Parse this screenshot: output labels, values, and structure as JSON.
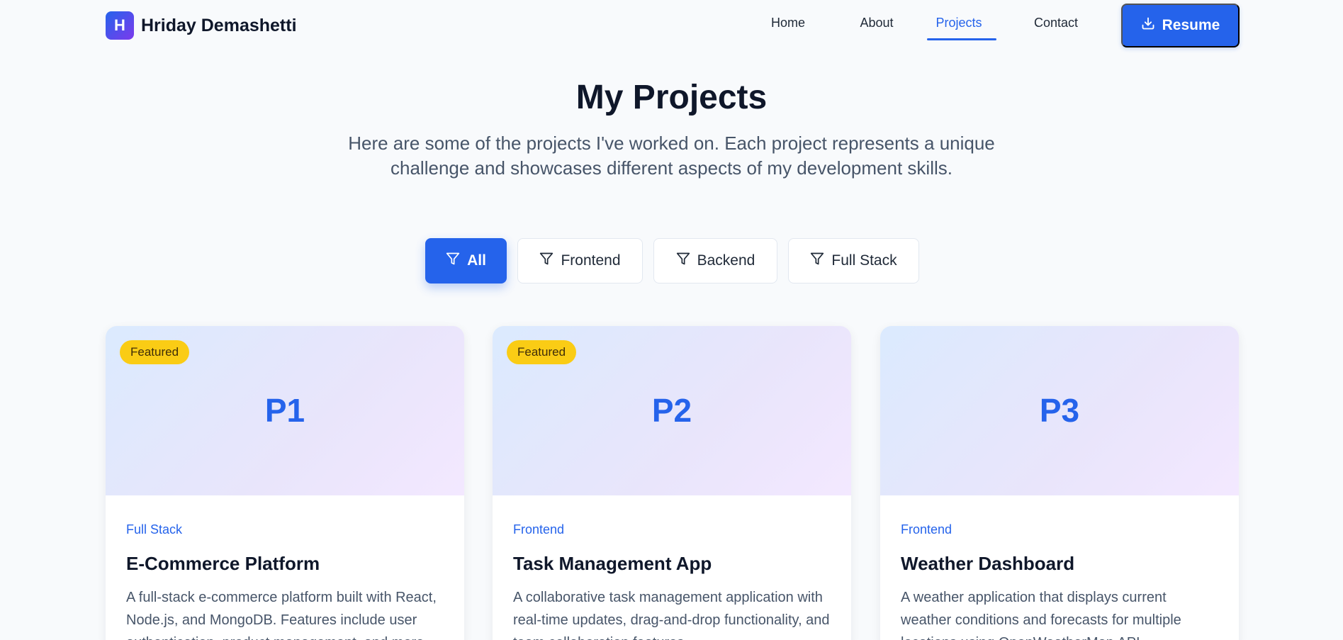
{
  "brand": {
    "logo_letter": "H",
    "name": "Hriday Demashetti"
  },
  "nav": {
    "links": [
      {
        "label": "Home",
        "active": false
      },
      {
        "label": "About",
        "active": false
      },
      {
        "label": "Projects",
        "active": true
      },
      {
        "label": "Contact",
        "active": false
      }
    ],
    "resume_label": "Resume"
  },
  "hero": {
    "title": "My Projects",
    "subtitle": "Here are some of the projects I've worked on. Each project represents a unique challenge and showcases different aspects of my development skills."
  },
  "filters": [
    {
      "label": "All",
      "active": true
    },
    {
      "label": "Frontend",
      "active": false
    },
    {
      "label": "Backend",
      "active": false
    },
    {
      "label": "Full Stack",
      "active": false
    }
  ],
  "projects": [
    {
      "code": "P1",
      "featured": true,
      "badge": "Featured",
      "category": "Full Stack",
      "title": "E-Commerce Platform",
      "description": "A full-stack e-commerce platform built with React, Node.js, and MongoDB. Features include user authentication, product management, and more."
    },
    {
      "code": "P2",
      "featured": true,
      "badge": "Featured",
      "category": "Frontend",
      "title": "Task Management App",
      "description": "A collaborative task management application with real-time updates, drag-and-drop functionality, and team collaboration features."
    },
    {
      "code": "P3",
      "featured": false,
      "badge": "",
      "category": "Frontend",
      "title": "Weather Dashboard",
      "description": "A weather application that displays current weather conditions and forecasts for multiple locations using OpenWeatherMap API."
    }
  ],
  "colors": {
    "accent": "#2563eb",
    "badge": "#facc15",
    "background": "#f8fafc"
  }
}
